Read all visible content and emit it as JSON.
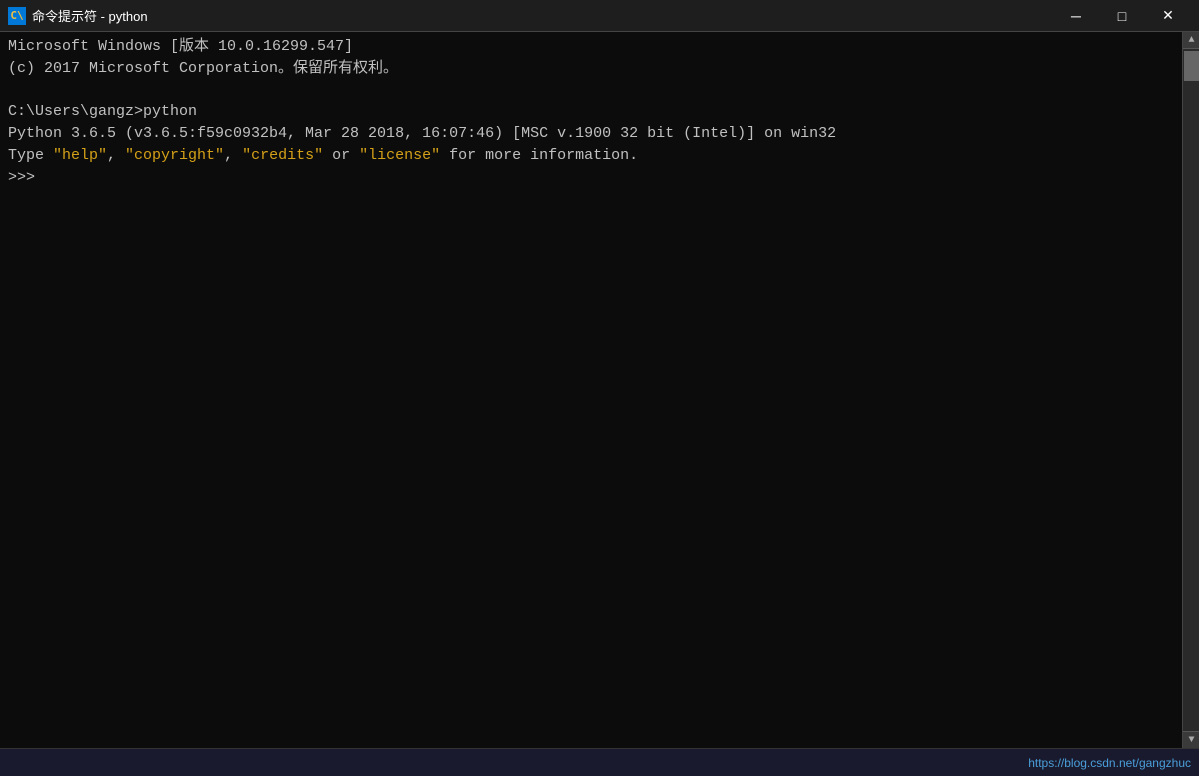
{
  "titleBar": {
    "iconLabel": "C:\\",
    "title": "命令提示符 - python",
    "minimizeLabel": "─",
    "maximizeLabel": "□",
    "closeLabel": "✕"
  },
  "console": {
    "line1": "Microsoft Windows [版本 10.0.16299.547]",
    "line2": "(c) 2017 Microsoft Corporation。保留所有权利。",
    "line3": "",
    "line4": "C:\\Users\\gangz>python",
    "line5": "Python 3.6.5 (v3.6.5:f59c0932b4, Mar 28 2018, 16:07:46) [MSC v.1900 32 bit (Intel)] on win32",
    "line6": "Type \"help\", \"copyright\", \"credits\" or \"license\" for more information.",
    "line7": ">>>"
  },
  "watermark": "https://blog.csdn.net/gangzhuc"
}
